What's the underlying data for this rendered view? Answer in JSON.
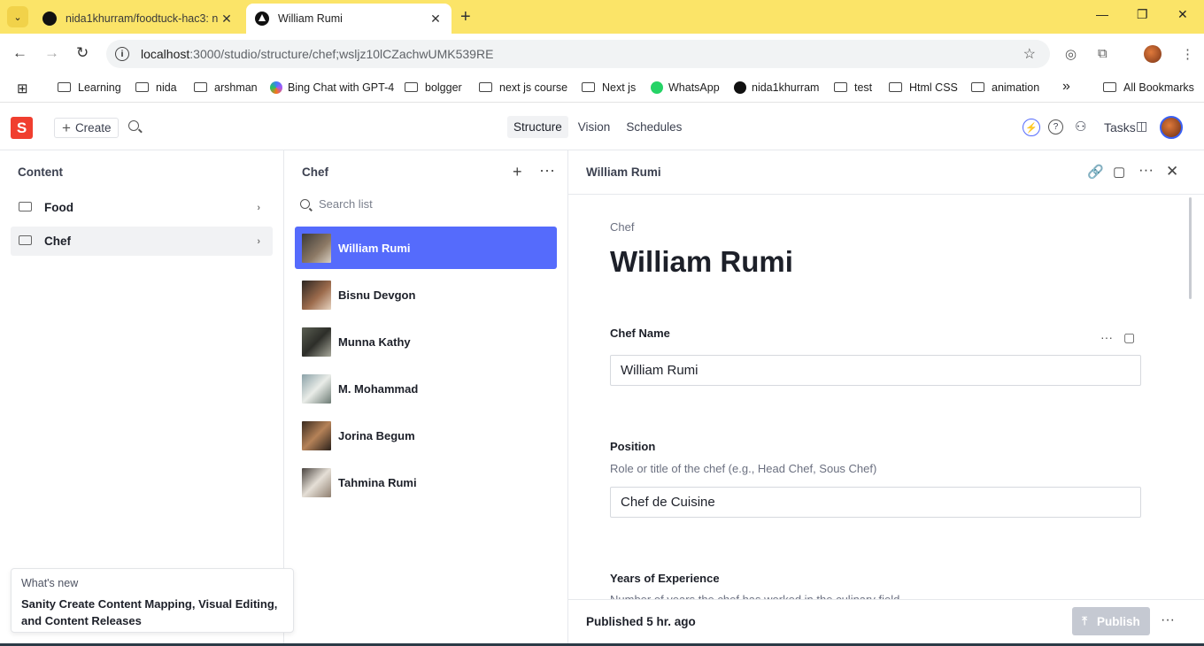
{
  "browser": {
    "tabs": [
      {
        "title": "nida1khurram/foodtuck-hac3: n",
        "active": false
      },
      {
        "title": "William Rumi",
        "active": true
      }
    ],
    "new_tab": "+",
    "window_controls": {
      "minimize": "—",
      "maximize": "❐",
      "close": "✕"
    },
    "url_host": "localhost",
    "url_path": ":3000/studio/structure/chef;wsljz10lCZachwUMK539RE",
    "bookmarks": [
      {
        "label": "Learning",
        "icon": "folder-icon"
      },
      {
        "label": "nida",
        "icon": "folder-icon"
      },
      {
        "label": "arshman",
        "icon": "folder-icon"
      },
      {
        "label": "Bing Chat with GPT-4",
        "icon": "bing-icon"
      },
      {
        "label": "bolgger",
        "icon": "folder-icon"
      },
      {
        "label": "next js course",
        "icon": "folder-icon"
      },
      {
        "label": "Next js",
        "icon": "folder-icon"
      },
      {
        "label": "WhatsApp",
        "icon": "whatsapp-icon"
      },
      {
        "label": "nida1khurram",
        "icon": "github-icon"
      },
      {
        "label": "test",
        "icon": "folder-icon"
      },
      {
        "label": "Html CSS",
        "icon": "folder-icon"
      },
      {
        "label": "animation",
        "icon": "folder-icon"
      }
    ],
    "bookmarks_overflow": "»",
    "all_bookmarks": "All Bookmarks"
  },
  "studio": {
    "logo_letter": "S",
    "create_label": "Create",
    "nav_tabs": [
      {
        "label": "Structure",
        "active": true
      },
      {
        "label": "Vision",
        "active": false
      },
      {
        "label": "Schedules",
        "active": false
      }
    ],
    "tasks_label": "Tasks",
    "accent_color": "#556bfc",
    "brand_color": "#f03e2f"
  },
  "content_pane": {
    "title": "Content",
    "items": [
      {
        "label": "Food",
        "selected": false
      },
      {
        "label": "Chef",
        "selected": true
      }
    ]
  },
  "chef_pane": {
    "title": "Chef",
    "search_placeholder": "Search list",
    "items": [
      {
        "name": "William Rumi",
        "selected": true
      },
      {
        "name": "Bisnu Devgon",
        "selected": false
      },
      {
        "name": "Munna Kathy",
        "selected": false
      },
      {
        "name": "M. Mohammad",
        "selected": false
      },
      {
        "name": "Jorina Begum",
        "selected": false
      },
      {
        "name": "Tahmina Rumi",
        "selected": false
      }
    ]
  },
  "document": {
    "header_title": "William Rumi",
    "type_label": "Chef",
    "title": "William Rumi",
    "fields": {
      "chef_name": {
        "label": "Chef Name",
        "value": "William Rumi"
      },
      "position": {
        "label": "Position",
        "description": "Role or title of the chef (e.g., Head Chef, Sous Chef)",
        "value": "Chef de Cuisine"
      },
      "experience": {
        "label": "Years of Experience",
        "description": "Number of years the chef has worked in the culinary field"
      }
    },
    "status": "Published 5 hr. ago",
    "publish_label": "Publish"
  },
  "whats_new": {
    "label": "What's new",
    "text": "Sanity Create Content Mapping, Visual Editing, and Content Releases"
  }
}
